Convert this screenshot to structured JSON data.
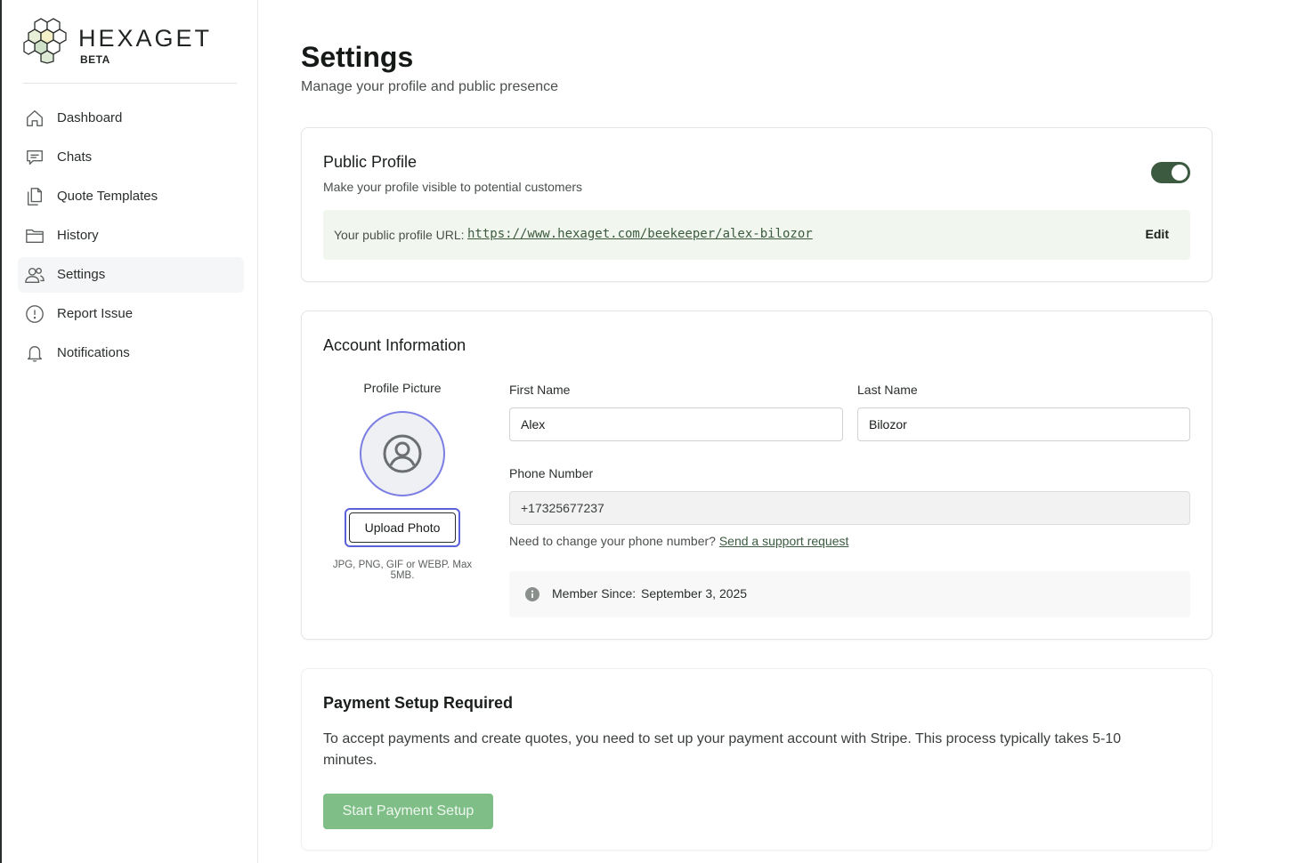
{
  "brand": {
    "name": "HEXAGET",
    "badge": "BETA",
    "logo_icon": "honeycomb-logo"
  },
  "sidebar": {
    "items": [
      {
        "label": "Dashboard",
        "icon": "home-icon"
      },
      {
        "label": "Chats",
        "icon": "chat-bubble-icon"
      },
      {
        "label": "Quote Templates",
        "icon": "documents-icon"
      },
      {
        "label": "History",
        "icon": "folder-icon"
      },
      {
        "label": "Settings",
        "icon": "users-icon",
        "active": true
      },
      {
        "label": "Report Issue",
        "icon": "alert-circle-icon"
      },
      {
        "label": "Notifications",
        "icon": "bell-icon"
      }
    ]
  },
  "page": {
    "title": "Settings",
    "subtitle": "Manage your profile and public presence"
  },
  "public_profile": {
    "title": "Public Profile",
    "description": "Make your profile visible to potential customers",
    "visible": true,
    "url_prefix": "Your public profile URL:",
    "url": "https://www.hexaget.com/beekeeper/alex-bilozor",
    "edit_label": "Edit"
  },
  "account": {
    "title": "Account Information",
    "profile_picture_label": "Profile Picture",
    "upload_label": "Upload Photo",
    "upload_hint": "JPG, PNG, GIF or WEBP. Max 5MB.",
    "first_name_label": "First Name",
    "first_name": "Alex",
    "last_name_label": "Last Name",
    "last_name": "Bilozor",
    "phone_label": "Phone Number",
    "phone": "+17325677237",
    "phone_note": "Need to change your phone number?",
    "phone_link": "Send a support request",
    "member_since_label": "Member Since:",
    "member_since": "September 3, 2025"
  },
  "payment": {
    "title": "Payment Setup Required",
    "text": "To accept payments and create quotes, you need to set up your payment account with Stripe. This process typically takes 5-10 minutes.",
    "button_label": "Start Payment Setup"
  },
  "colors": {
    "accent": "#3b5a3f",
    "url_bg": "#f1f7ee",
    "payment_button": "#7fbf87",
    "focus_ring": "#5b5fd8"
  }
}
